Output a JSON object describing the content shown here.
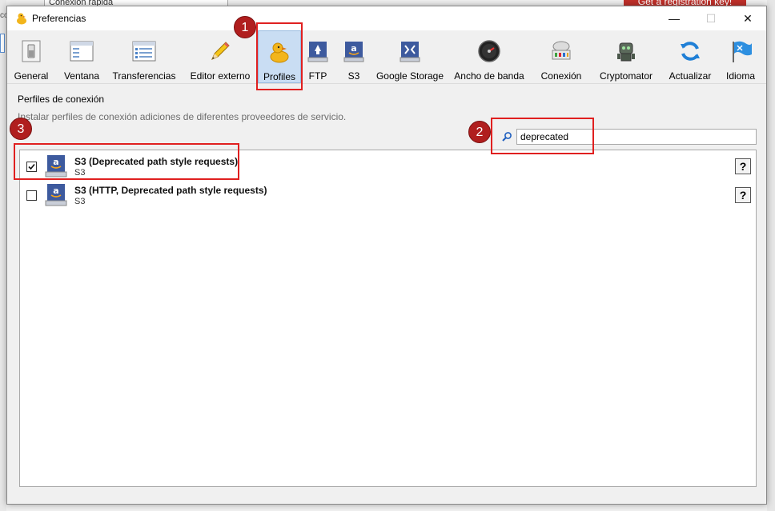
{
  "background": {
    "quick_connect": "Conexión rápida",
    "registration": "Get a registration key!",
    "left_text": "co"
  },
  "window": {
    "title": "Preferencias",
    "minimize": "—",
    "maximize": "☐",
    "close": "✕"
  },
  "toolbar": {
    "items": [
      {
        "label": "General",
        "icon": "switch-icon"
      },
      {
        "label": "Ventana",
        "icon": "window-icon"
      },
      {
        "label": "Transferencias",
        "icon": "list-window-icon"
      },
      {
        "label": "Editor externo",
        "icon": "pencil-icon"
      },
      {
        "label": "Profiles",
        "icon": "duck-icon",
        "selected": true
      },
      {
        "label": "FTP",
        "icon": "ftp-drive-icon"
      },
      {
        "label": "S3",
        "icon": "amazon-drive-icon"
      },
      {
        "label": "Google Storage",
        "icon": "google-storage-icon"
      },
      {
        "label": "Ancho de banda",
        "icon": "speedometer-icon"
      },
      {
        "label": "Conexión",
        "icon": "network-icon"
      },
      {
        "label": "Cryptomator",
        "icon": "robot-icon"
      },
      {
        "label": "Actualizar",
        "icon": "refresh-icon"
      },
      {
        "label": "Idioma",
        "icon": "flag-icon"
      }
    ]
  },
  "section": {
    "title": "Perfiles de conexión",
    "description": "Instalar perfiles de conexión adiciones de diferentes proveedores de servicio."
  },
  "search": {
    "value": "deprecated"
  },
  "profiles": [
    {
      "name": "S3 (Deprecated path style requests)",
      "protocol": "S3",
      "checked": true,
      "help": "?"
    },
    {
      "name": "S3 (HTTP, Deprecated path style requests)",
      "protocol": "S3",
      "checked": false,
      "help": "?"
    }
  ],
  "annotations": {
    "badge1": "1",
    "badge2": "2",
    "badge3": "3",
    "color": "#e02020"
  }
}
